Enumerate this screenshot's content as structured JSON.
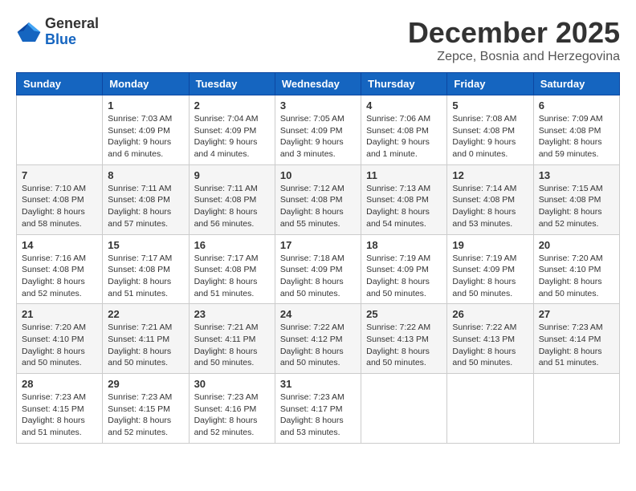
{
  "logo": {
    "general": "General",
    "blue": "Blue"
  },
  "header": {
    "month": "December 2025",
    "location": "Zepce, Bosnia and Herzegovina"
  },
  "weekdays": [
    "Sunday",
    "Monday",
    "Tuesday",
    "Wednesday",
    "Thursday",
    "Friday",
    "Saturday"
  ],
  "weeks": [
    [
      {
        "day": "",
        "info": ""
      },
      {
        "day": "1",
        "info": "Sunrise: 7:03 AM\nSunset: 4:09 PM\nDaylight: 9 hours\nand 6 minutes."
      },
      {
        "day": "2",
        "info": "Sunrise: 7:04 AM\nSunset: 4:09 PM\nDaylight: 9 hours\nand 4 minutes."
      },
      {
        "day": "3",
        "info": "Sunrise: 7:05 AM\nSunset: 4:09 PM\nDaylight: 9 hours\nand 3 minutes."
      },
      {
        "day": "4",
        "info": "Sunrise: 7:06 AM\nSunset: 4:08 PM\nDaylight: 9 hours\nand 1 minute."
      },
      {
        "day": "5",
        "info": "Sunrise: 7:08 AM\nSunset: 4:08 PM\nDaylight: 9 hours\nand 0 minutes."
      },
      {
        "day": "6",
        "info": "Sunrise: 7:09 AM\nSunset: 4:08 PM\nDaylight: 8 hours\nand 59 minutes."
      }
    ],
    [
      {
        "day": "7",
        "info": "Sunrise: 7:10 AM\nSunset: 4:08 PM\nDaylight: 8 hours\nand 58 minutes."
      },
      {
        "day": "8",
        "info": "Sunrise: 7:11 AM\nSunset: 4:08 PM\nDaylight: 8 hours\nand 57 minutes."
      },
      {
        "day": "9",
        "info": "Sunrise: 7:11 AM\nSunset: 4:08 PM\nDaylight: 8 hours\nand 56 minutes."
      },
      {
        "day": "10",
        "info": "Sunrise: 7:12 AM\nSunset: 4:08 PM\nDaylight: 8 hours\nand 55 minutes."
      },
      {
        "day": "11",
        "info": "Sunrise: 7:13 AM\nSunset: 4:08 PM\nDaylight: 8 hours\nand 54 minutes."
      },
      {
        "day": "12",
        "info": "Sunrise: 7:14 AM\nSunset: 4:08 PM\nDaylight: 8 hours\nand 53 minutes."
      },
      {
        "day": "13",
        "info": "Sunrise: 7:15 AM\nSunset: 4:08 PM\nDaylight: 8 hours\nand 52 minutes."
      }
    ],
    [
      {
        "day": "14",
        "info": "Sunrise: 7:16 AM\nSunset: 4:08 PM\nDaylight: 8 hours\nand 52 minutes."
      },
      {
        "day": "15",
        "info": "Sunrise: 7:17 AM\nSunset: 4:08 PM\nDaylight: 8 hours\nand 51 minutes."
      },
      {
        "day": "16",
        "info": "Sunrise: 7:17 AM\nSunset: 4:08 PM\nDaylight: 8 hours\nand 51 minutes."
      },
      {
        "day": "17",
        "info": "Sunrise: 7:18 AM\nSunset: 4:09 PM\nDaylight: 8 hours\nand 50 minutes."
      },
      {
        "day": "18",
        "info": "Sunrise: 7:19 AM\nSunset: 4:09 PM\nDaylight: 8 hours\nand 50 minutes."
      },
      {
        "day": "19",
        "info": "Sunrise: 7:19 AM\nSunset: 4:09 PM\nDaylight: 8 hours\nand 50 minutes."
      },
      {
        "day": "20",
        "info": "Sunrise: 7:20 AM\nSunset: 4:10 PM\nDaylight: 8 hours\nand 50 minutes."
      }
    ],
    [
      {
        "day": "21",
        "info": "Sunrise: 7:20 AM\nSunset: 4:10 PM\nDaylight: 8 hours\nand 50 minutes."
      },
      {
        "day": "22",
        "info": "Sunrise: 7:21 AM\nSunset: 4:11 PM\nDaylight: 8 hours\nand 50 minutes."
      },
      {
        "day": "23",
        "info": "Sunrise: 7:21 AM\nSunset: 4:11 PM\nDaylight: 8 hours\nand 50 minutes."
      },
      {
        "day": "24",
        "info": "Sunrise: 7:22 AM\nSunset: 4:12 PM\nDaylight: 8 hours\nand 50 minutes."
      },
      {
        "day": "25",
        "info": "Sunrise: 7:22 AM\nSunset: 4:13 PM\nDaylight: 8 hours\nand 50 minutes."
      },
      {
        "day": "26",
        "info": "Sunrise: 7:22 AM\nSunset: 4:13 PM\nDaylight: 8 hours\nand 50 minutes."
      },
      {
        "day": "27",
        "info": "Sunrise: 7:23 AM\nSunset: 4:14 PM\nDaylight: 8 hours\nand 51 minutes."
      }
    ],
    [
      {
        "day": "28",
        "info": "Sunrise: 7:23 AM\nSunset: 4:15 PM\nDaylight: 8 hours\nand 51 minutes."
      },
      {
        "day": "29",
        "info": "Sunrise: 7:23 AM\nSunset: 4:15 PM\nDaylight: 8 hours\nand 52 minutes."
      },
      {
        "day": "30",
        "info": "Sunrise: 7:23 AM\nSunset: 4:16 PM\nDaylight: 8 hours\nand 52 minutes."
      },
      {
        "day": "31",
        "info": "Sunrise: 7:23 AM\nSunset: 4:17 PM\nDaylight: 8 hours\nand 53 minutes."
      },
      {
        "day": "",
        "info": ""
      },
      {
        "day": "",
        "info": ""
      },
      {
        "day": "",
        "info": ""
      }
    ]
  ]
}
